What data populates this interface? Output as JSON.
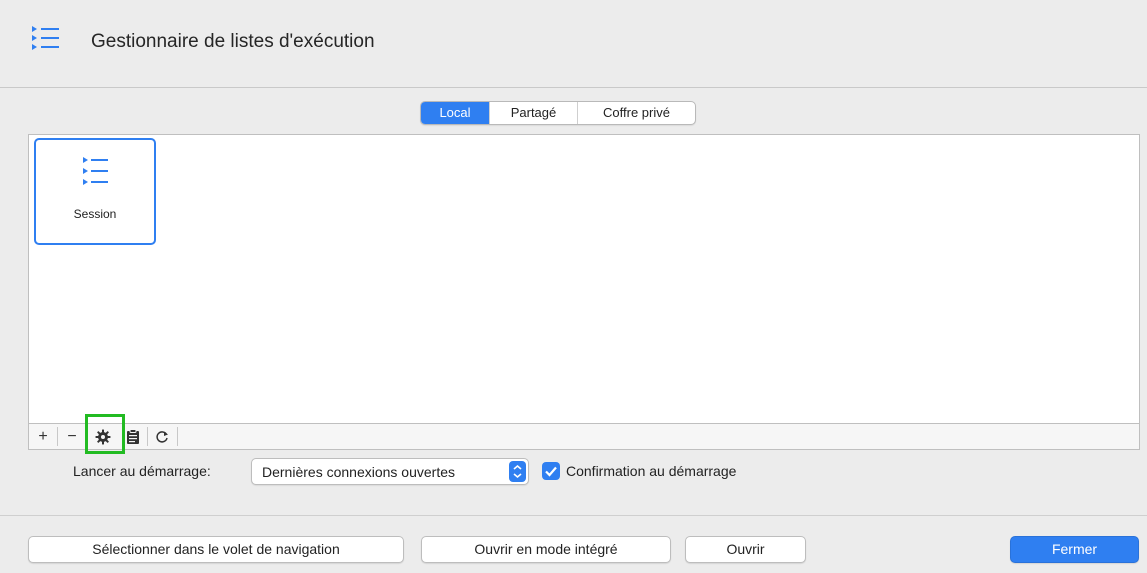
{
  "window": {
    "title": "Gestionnaire de listes d'exécution",
    "icon": "list-icon"
  },
  "tabs": [
    {
      "label": "Local",
      "active": true
    },
    {
      "label": "Partagé",
      "active": false
    },
    {
      "label": "Coffre privé",
      "active": false
    }
  ],
  "items": [
    {
      "label": "Session",
      "icon": "list-icon",
      "selected": true
    }
  ],
  "toolbar": {
    "add": "+",
    "remove": "−",
    "settings_icon": "gear-icon",
    "duplicate_icon": "clipboard-icon",
    "refresh_icon": "refresh-icon"
  },
  "startup": {
    "label": "Lancer au démarrage:",
    "selected_option": "Dernières connexions ouvertes",
    "confirm_label": "Confirmation au démarrage",
    "confirm_checked": true
  },
  "buttons": {
    "select_nav": "Sélectionner dans le volet de navigation",
    "open_embedded": "Ouvrir en mode intégré",
    "open": "Ouvrir",
    "close": "Fermer"
  },
  "colors": {
    "accent": "#2f7ff1",
    "highlight": "#22bb22"
  }
}
